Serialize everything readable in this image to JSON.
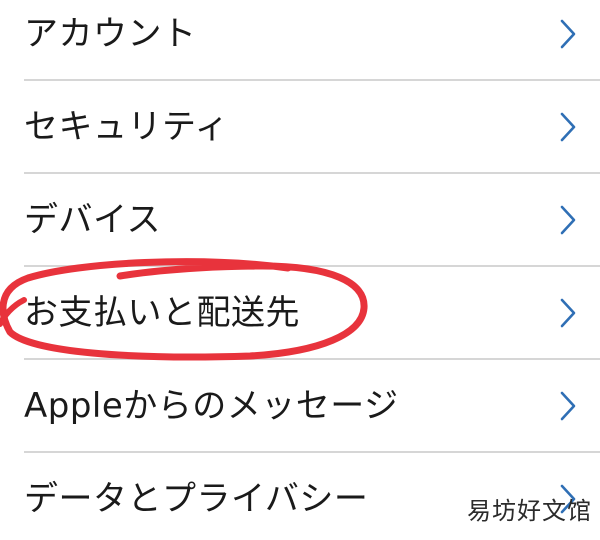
{
  "menu": {
    "items": [
      {
        "label": "アカウント"
      },
      {
        "label": "セキュリティ"
      },
      {
        "label": "デバイス"
      },
      {
        "label": "お支払いと配送先"
      },
      {
        "label": "Appleからのメッセージ"
      },
      {
        "label": "データとプライバシー"
      }
    ]
  },
  "watermark": {
    "text": "易坊好文馆"
  },
  "colors": {
    "chevron": "#2f6fb5",
    "divider": "#d6d6d6",
    "highlight_circle": "#e8333c"
  },
  "icons": {
    "row_chevron": "chevron-right-icon"
  }
}
